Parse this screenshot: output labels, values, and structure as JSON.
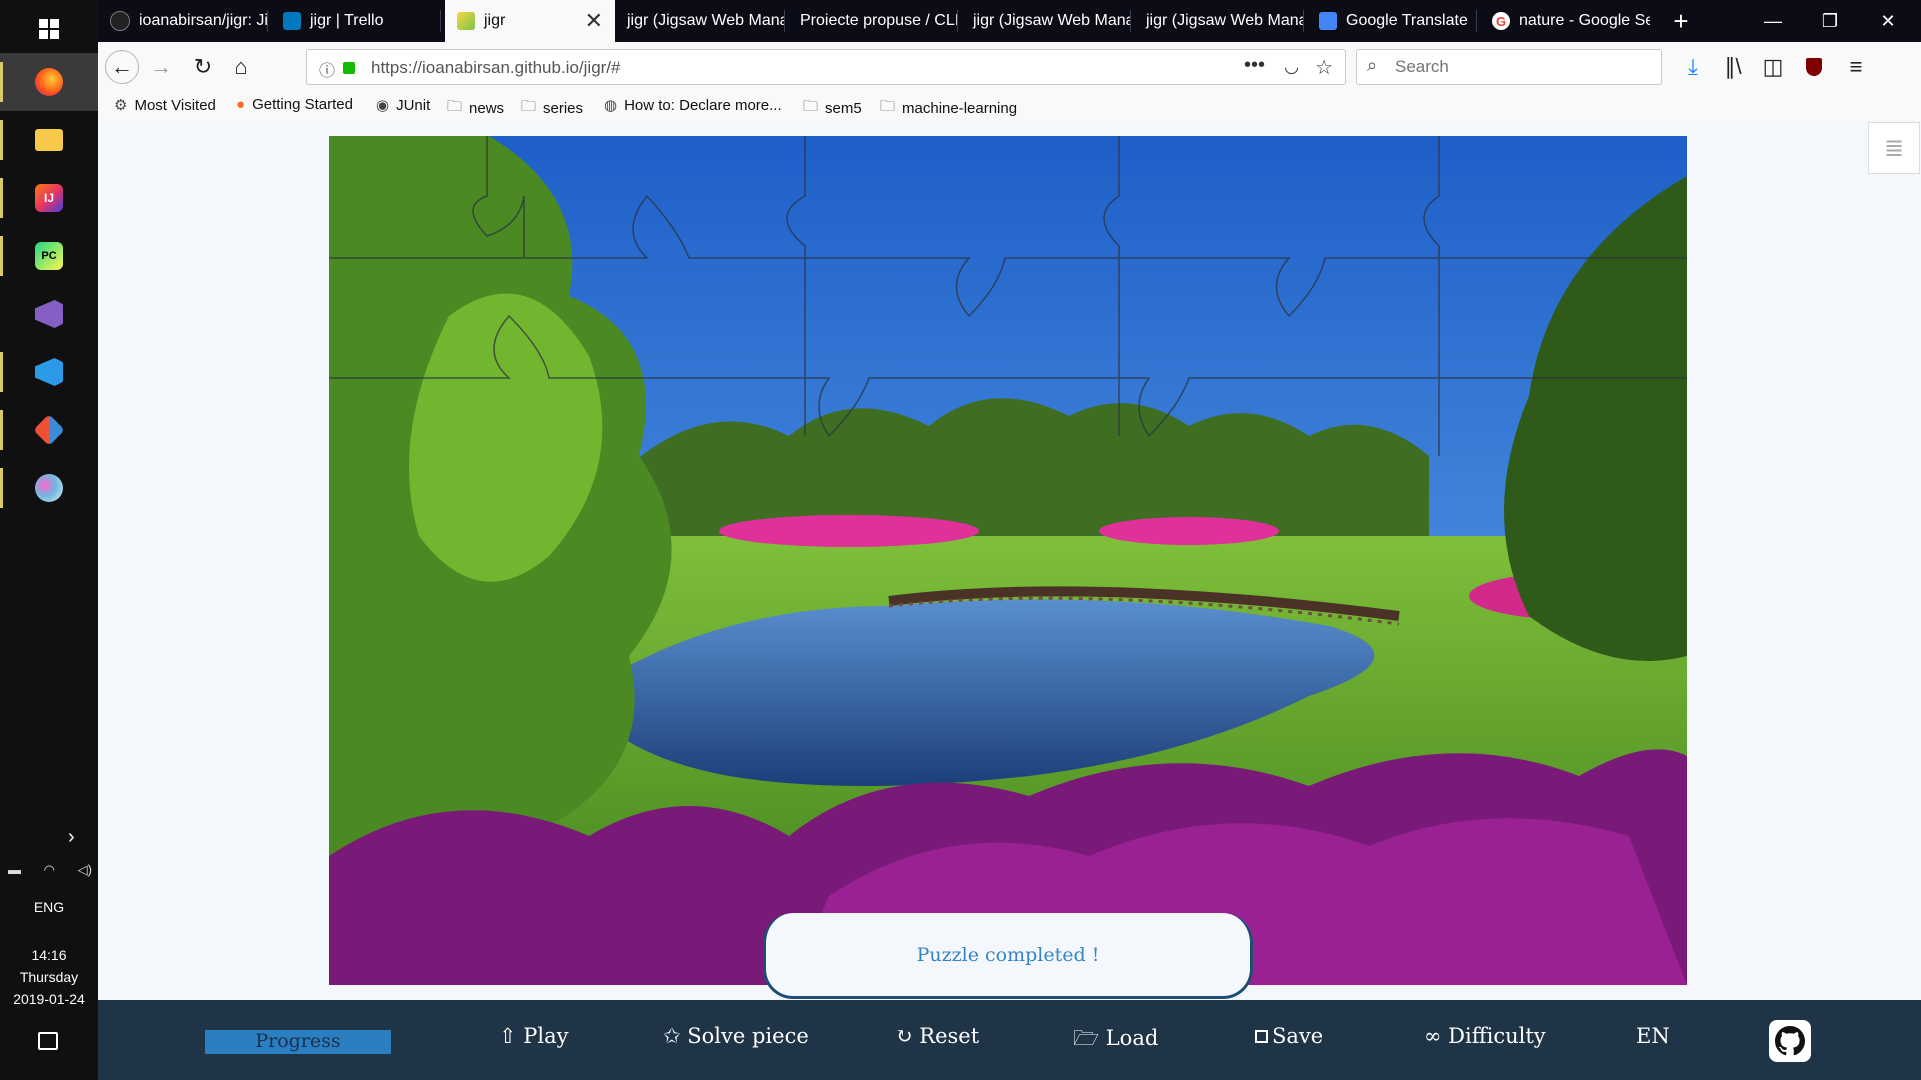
{
  "taskbar": {
    "apps": [
      {
        "name": "firefox",
        "color": "#ff7a1a"
      },
      {
        "name": "file-explorer",
        "color": "#f7c948"
      },
      {
        "name": "intellij",
        "color": "#e8375e"
      },
      {
        "name": "pycharm",
        "color": "#21d789"
      },
      {
        "name": "visual-studio",
        "color": "#865fc5"
      },
      {
        "name": "vscode",
        "color": "#2b9ae8"
      },
      {
        "name": "git",
        "color": "#f05033"
      },
      {
        "name": "paint",
        "color": "#70b8e0"
      }
    ],
    "language": "ENG",
    "time": "14:16",
    "day": "Thursday",
    "date": "2019-01-24"
  },
  "tabs": [
    {
      "title": "ioanabirsan/jigr: Ji",
      "icon": "github-icon",
      "color": "#ffffff"
    },
    {
      "title": "jigr | Trello",
      "icon": "trello-icon",
      "color": "#0079bf"
    },
    {
      "title": "jigr",
      "icon": "jigr-icon",
      "color": "#7fc34a",
      "active": true
    },
    {
      "title": "jigr (Jigsaw Web Mana",
      "icon": "",
      "color": ""
    },
    {
      "title": "Proiecte propuse / CLI",
      "icon": "",
      "color": ""
    },
    {
      "title": "jigr (Jigsaw Web Mana",
      "icon": "",
      "color": ""
    },
    {
      "title": "jigr (Jigsaw Web Mana",
      "icon": "",
      "color": ""
    },
    {
      "title": "Google Translate",
      "icon": "translate-icon",
      "color": "#4285f4"
    },
    {
      "title": "nature - Google Se",
      "icon": "google-icon",
      "color": "#ea4335"
    }
  ],
  "navbar": {
    "url": "https://ioanabirsan.github.io/jigr/#",
    "search_placeholder": "Search"
  },
  "bookmarks": [
    {
      "label": "Most Visited",
      "icon": "gear-icon"
    },
    {
      "label": "Getting Started",
      "icon": "firefox-icon"
    },
    {
      "label": "JUnit",
      "icon": "github-icon"
    },
    {
      "label": "news",
      "icon": "folder-icon"
    },
    {
      "label": "series",
      "icon": "folder-icon"
    },
    {
      "label": "How to: Declare more...",
      "icon": "globe-icon"
    },
    {
      "label": "sem5",
      "icon": "folder-icon"
    },
    {
      "label": "machine-learning",
      "icon": "folder-icon"
    }
  ],
  "toast": {
    "message": "Puzzle completed !"
  },
  "toolbar": {
    "progress_label": "Progress",
    "progress_color": "#2b7ec0",
    "play": "⇧ Play",
    "solve": "✩ Solve piece",
    "reset": "↻ Reset",
    "load": "Load",
    "save": "Save",
    "difficulty": "∞ Difficulty",
    "language": "EN"
  }
}
